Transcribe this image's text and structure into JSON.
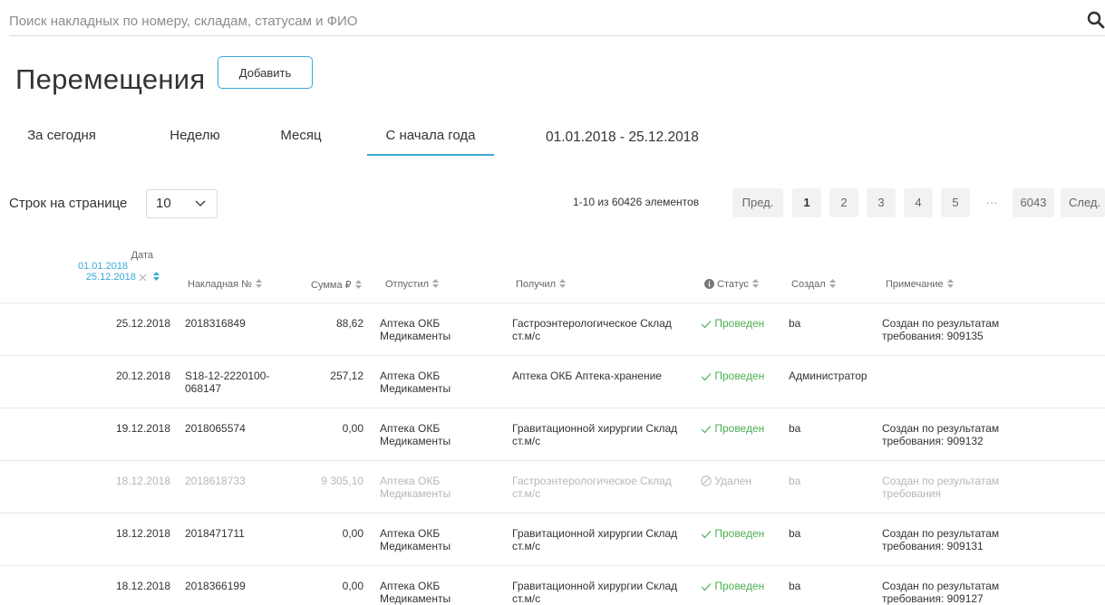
{
  "search": {
    "placeholder": "Поиск накладных по номеру, складам, статусам и ФИО"
  },
  "page": {
    "title": "Перемещения",
    "add_label": "Добавить"
  },
  "tabs": [
    {
      "label": "За сегодня"
    },
    {
      "label": "Неделю"
    },
    {
      "label": "Месяц"
    },
    {
      "label": "С начала года",
      "active": true
    }
  ],
  "date_range": "01.01.2018 - 25.12.2018",
  "pagination": {
    "rows_label": "Строк на странице",
    "rows_value": "10",
    "info": "1-10 из 60426 элементов",
    "prev": "Пред.",
    "pages": [
      "1",
      "2",
      "3",
      "4",
      "5"
    ],
    "ellipsis": "···",
    "last": "6043",
    "next": "След."
  },
  "columns": {
    "date": "Дата",
    "date_from": "01.01.2018",
    "date_to": "25.12.2018",
    "number": "Накладная №",
    "sum": "Сумма ₽",
    "sender": "Отпустил",
    "receiver": "Получил",
    "status": "Статус",
    "creator": "Создал",
    "note": "Примечание"
  },
  "rows": [
    {
      "date": "25.12.2018",
      "number": "2018316849",
      "number2": "",
      "sum": "88,62",
      "sender1": "Аптека ОКБ",
      "sender2": "Медикаменты",
      "receiver1": "Гастроэнтерологическое Склад",
      "receiver2": "ст.м/с",
      "status": "Проведен",
      "creator": "ba",
      "note1": "Создан по результатам",
      "note2": "требования: 909135"
    },
    {
      "date": "20.12.2018",
      "number": "S18-12-2220100-",
      "number2": "068147",
      "sum": "257,12",
      "sender1": "Аптека ОКБ",
      "sender2": "Медикаменты",
      "receiver1": "Аптека ОКБ Аптека-хранение",
      "receiver2": "",
      "status": "Проведен",
      "creator": "Администратор",
      "note1": "",
      "note2": ""
    },
    {
      "date": "19.12.2018",
      "number": "2018065574",
      "number2": "",
      "sum": "0,00",
      "sender1": "Аптека ОКБ",
      "sender2": "Медикаменты",
      "receiver1": "Гравитационной хирургии Склад",
      "receiver2": "ст.м/с",
      "status": "Проведен",
      "creator": "ba",
      "note1": "Создан по результатам",
      "note2": "требования: 909132"
    },
    {
      "date": "18.12.2018",
      "number": "2018618733",
      "number2": "",
      "sum": "9 305,10",
      "sender1": "Аптека ОКБ",
      "sender2": "Медикаменты",
      "receiver1": "Гастроэнтерологическое Склад",
      "receiver2": "ст.м/с",
      "status": "Удален",
      "creator": "ba",
      "note1": "Создан по результатам",
      "note2": "требования"
    },
    {
      "date": "18.12.2018",
      "number": "2018471711",
      "number2": "",
      "sum": "0,00",
      "sender1": "Аптека ОКБ",
      "sender2": "Медикаменты",
      "receiver1": "Гравитационной хирургии Склад",
      "receiver2": "ст.м/с",
      "status": "Проведен",
      "creator": "ba",
      "note1": "Создан по результатам",
      "note2": "требования: 909131"
    },
    {
      "date": "18.12.2018",
      "number": "2018366199",
      "number2": "",
      "sum": "0,00",
      "sender1": "Аптека ОКБ",
      "sender2": "Медикаменты",
      "receiver1": "Гравитационной хирургии Склад",
      "receiver2": "ст.м/с",
      "status": "Проведен",
      "creator": "ba",
      "note1": "Создан по результатам",
      "note2": "требования: 909127"
    }
  ],
  "colors": {
    "accent": "#38a9d8",
    "success": "#4caf50",
    "muted": "#b7b7b7"
  },
  "icons": {
    "search": "search-icon",
    "sort": "sort-icon",
    "status_ok": "check-icon",
    "status_deleted": "ban-icon",
    "info": "info-icon",
    "clear": "close-icon",
    "dropdown": "chevron-down-icon"
  }
}
